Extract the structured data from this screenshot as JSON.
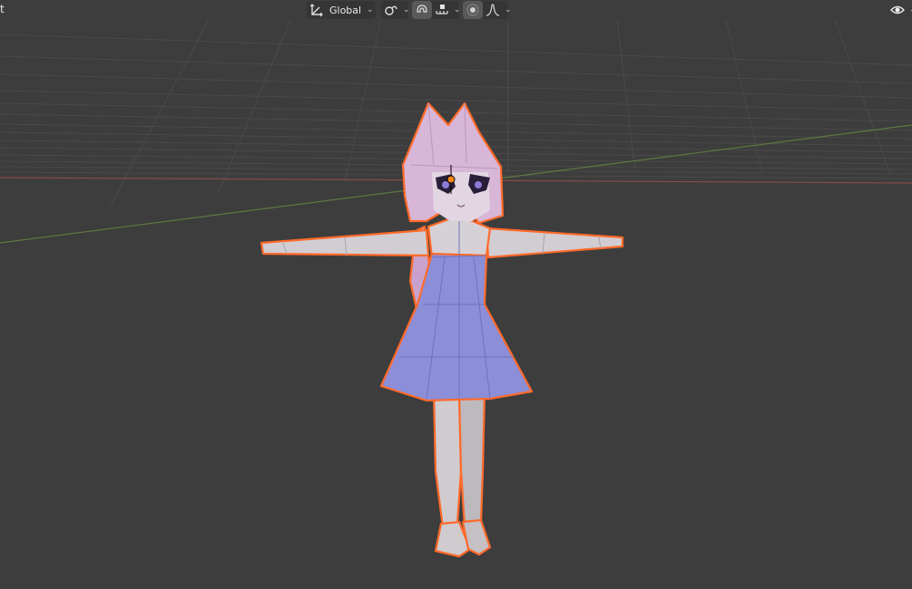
{
  "header": {
    "left_fragment": "t",
    "transform_orientation": {
      "label": "Global",
      "icon": "transform-orientation-icon"
    },
    "pivot": {
      "icon": "pivot-point-icon"
    },
    "snap": {
      "icon": "snap-magnet-icon",
      "target_icon": "snap-increment-icon"
    },
    "proportional_editing": {
      "icon": "proportional-editing-icon",
      "falloff_icon": "falloff-curve-icon"
    },
    "overlay": {
      "icon": "visibility-eye-icon"
    }
  },
  "colors": {
    "viewport_bg": "#3d3d3d",
    "grid": "#4a4a4a",
    "axis_x": "#8a4a4a",
    "axis_y": "#5e7a3e",
    "selection_outline": "#ff6a2a",
    "skin": "#d2cdd2",
    "hair": "#d8b6d8",
    "dress": "#8c8ed8"
  },
  "scene": {
    "object": "character-model"
  }
}
